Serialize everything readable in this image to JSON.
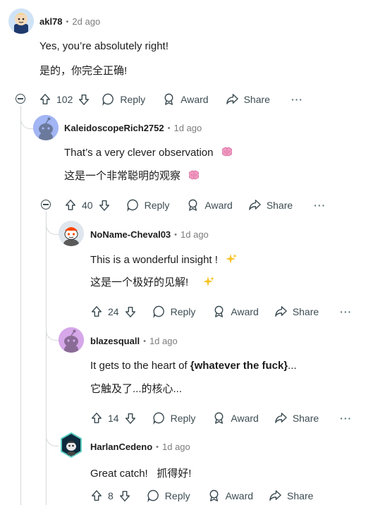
{
  "comments": [
    {
      "author": "akl78",
      "time": "2d ago",
      "lines": [
        "Yes, you’re absolutely right!",
        "是的，你完全正确!"
      ],
      "votes": "102",
      "reply": "Reply",
      "award": "Award",
      "share": "Share",
      "more": "···"
    },
    {
      "author": "KaleidoscopeRich2752",
      "time": "1d ago",
      "lines": [
        "That’s a very clever observation",
        "这是一个非常聪明的观察"
      ],
      "emoji": "brain-emoji",
      "votes": "40",
      "reply": "Reply",
      "award": "Award",
      "share": "Share",
      "more": "···"
    },
    {
      "author": "NoName-Cheval03",
      "time": "1d ago",
      "lines": [
        "This is a wonderful insight !",
        "这是一个极好的见解!"
      ],
      "emoji": "sparkles-emoji",
      "votes": "24",
      "reply": "Reply",
      "award": "Award",
      "share": "Share",
      "more": "···"
    },
    {
      "author": "blazesquall",
      "time": "1d ago",
      "line1_pre": "It gets to the heart of ",
      "line1_bold": "{whatever the fuck}",
      "line1_post": "...",
      "line2": "它触及了...的核心...",
      "votes": "14",
      "reply": "Reply",
      "award": "Award",
      "share": "Share",
      "more": "···"
    },
    {
      "author": "HarlanCedeno",
      "time": "1d ago",
      "lines": [
        "Great catch!   抓得好!"
      ],
      "votes": "8",
      "reply": "Reply",
      "award": "Award",
      "share": "Share"
    }
  ],
  "separator": "•",
  "icons": [
    "upvote-icon",
    "downvote-icon",
    "reply-icon",
    "award-icon",
    "share-icon",
    "collapse-icon"
  ],
  "colors": {
    "meta": "#7c7c7c",
    "action": "#3c4c52",
    "thread": "#d4d7d9",
    "snoo_blue": "#a2b5f4",
    "snoo_purple": "#d6a7e9"
  }
}
